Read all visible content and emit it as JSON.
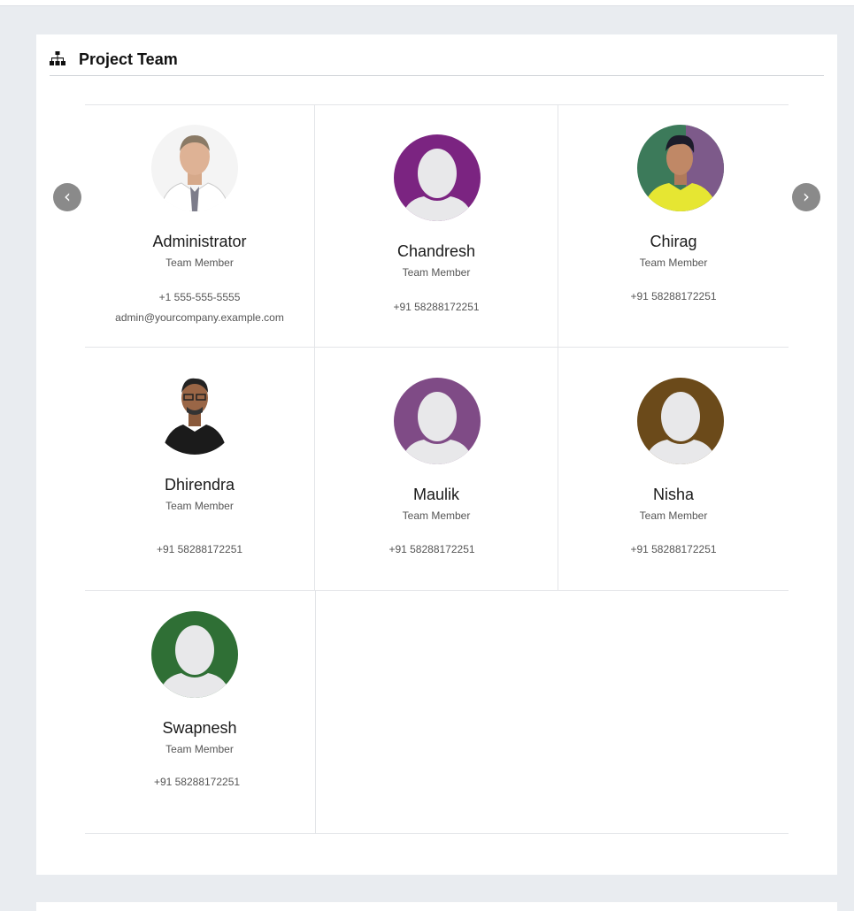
{
  "section": {
    "title": "Project Team",
    "icon": "sitemap-icon"
  },
  "carousel": {
    "prev_label": "‹",
    "next_label": "›"
  },
  "members": [
    {
      "name": "Administrator",
      "role": "Team Member",
      "phone": "+1 555-555-5555",
      "email": "admin@yourcompany.example.com",
      "avatar": "photo",
      "avatar_color": "#f2f2f2"
    },
    {
      "name": "Chandresh",
      "role": "Team Member",
      "phone": "+91 58288172251",
      "avatar": "placeholder",
      "avatar_color": "#7b2481"
    },
    {
      "name": "Chirag",
      "role": "Team Member",
      "phone": "+91 58288172251",
      "avatar": "photo",
      "avatar_color": "#d9d630"
    },
    {
      "name": "Dhirendra",
      "role": "Team Member",
      "phone": "+91 58288172251",
      "avatar": "photo",
      "avatar_color": "#1b1b1b"
    },
    {
      "name": "Maulik",
      "role": "Team Member",
      "phone": "+91 58288172251",
      "avatar": "placeholder",
      "avatar_color": "#7f4b86"
    },
    {
      "name": "Nisha",
      "role": "Team Member",
      "phone": "+91 58288172251",
      "avatar": "placeholder",
      "avatar_color": "#6b4a1a"
    },
    {
      "name": "Swapnesh",
      "role": "Team Member",
      "phone": "+91 58288172251",
      "avatar": "placeholder",
      "avatar_color": "#2f6f35"
    }
  ]
}
